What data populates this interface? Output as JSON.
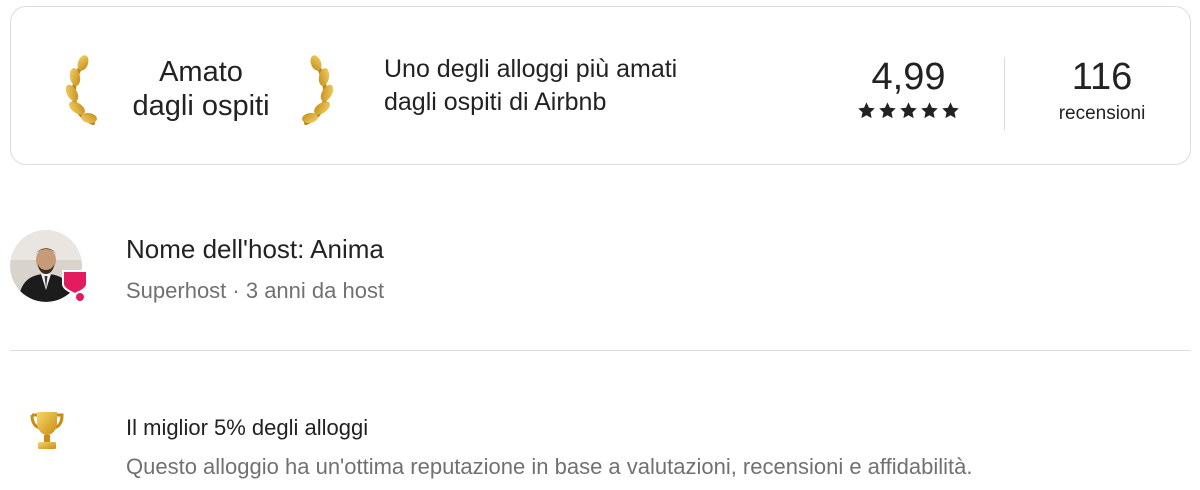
{
  "guest_favorite": {
    "badge_line1": "Amato",
    "badge_line2": "dagli ospiti",
    "description_line1": "Uno degli alloggi più amati",
    "description_line2": "dagli ospiti di Airbnb",
    "rating": "4,99",
    "stars": 5,
    "reviews_count": "116",
    "reviews_label": "recensioni",
    "icons": [
      "laurel-left-icon",
      "laurel-right-icon",
      "star-icon"
    ]
  },
  "host": {
    "name_line": "Nome dell'host: Anima",
    "meta": "Superhost · 3 anni da host",
    "icons": [
      "host-avatar",
      "superhost-badge-icon"
    ]
  },
  "highlight": {
    "title": "Il miglior 5% degli alloggi",
    "description": "Questo alloggio ha un'ottima reputazione in base a valutazioni, recensioni e affidabilità.",
    "icon": "trophy-icon"
  },
  "colors": {
    "text_primary": "#222222",
    "text_secondary": "#717171",
    "border": "#dddddd",
    "gold": "#d9a520",
    "superhost_pink": "#e31c5f"
  }
}
